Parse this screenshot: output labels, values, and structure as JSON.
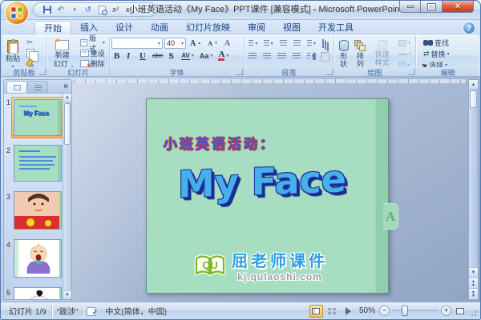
{
  "icons": {
    "undo": "↶",
    "redo": "↺",
    "caret": "▾",
    "close": "×",
    "help": "?",
    "cut": "✂",
    "replace_arrows": "⇄",
    "up": "▲",
    "down": "▼",
    "minus": "−",
    "plus": "+",
    "superscript": "x²",
    "subscript": "x₂"
  },
  "titlebar": {
    "title": "小班英语活动《My Face》PPT课件 [兼容模式] - Microsoft PowerPoint"
  },
  "tabs": {
    "home": "开始",
    "insert": "插入",
    "design": "设计",
    "animations": "动画",
    "slideshow": "幻灯片放映",
    "review": "审阅",
    "view": "视图",
    "developer": "开发工具"
  },
  "ribbon": {
    "clipboard": {
      "label": "剪贴板",
      "paste": "粘贴"
    },
    "slides": {
      "label": "幻灯片",
      "new_slide_line1": "新建",
      "new_slide_line2": "幻灯片",
      "layout": "版式",
      "reset": "重设",
      "delete": "删除"
    },
    "font": {
      "label": "字体",
      "size": "40",
      "bold": "B",
      "italic": "I",
      "underline": "U",
      "strikethrough": "abe",
      "shadow": "S",
      "char_spacing": "AV",
      "change_case": "Aa",
      "grow": "A",
      "shrink": "A",
      "color": "A"
    },
    "paragraph": {
      "label": "段落"
    },
    "drawing": {
      "label": "绘图",
      "shapes": "形状",
      "arrange": "排列",
      "quick_styles": "快速样式"
    },
    "editing": {
      "label": "编辑",
      "find": "查找",
      "replace": "替换",
      "select": "选择"
    }
  },
  "thumbnails": [
    {
      "num": "1"
    },
    {
      "num": "2"
    },
    {
      "num": "3"
    },
    {
      "num": "4"
    },
    {
      "num": "5"
    }
  ],
  "slide": {
    "subtitle": "小班英语活动：",
    "title": "My Face",
    "side_tab": "A",
    "watermark": {
      "logo": "QU",
      "brand": "屈老师课件",
      "site": "kj.qulaoshi.com"
    }
  },
  "statusbar": {
    "slide_counter": "幻灯片 1/9",
    "theme": "“跋涉”",
    "language": "中文(简体，中国)",
    "zoom_level": "50%"
  },
  "colors": {
    "slide_green": "#a7ddc0",
    "wordart_blue": "#45b0ea",
    "wordart_outline": "#1c2f9d",
    "brand_blue": "#2aa0e4",
    "logo_green": "#7cb821",
    "selected_thumb_orange": "#f0b45c"
  }
}
